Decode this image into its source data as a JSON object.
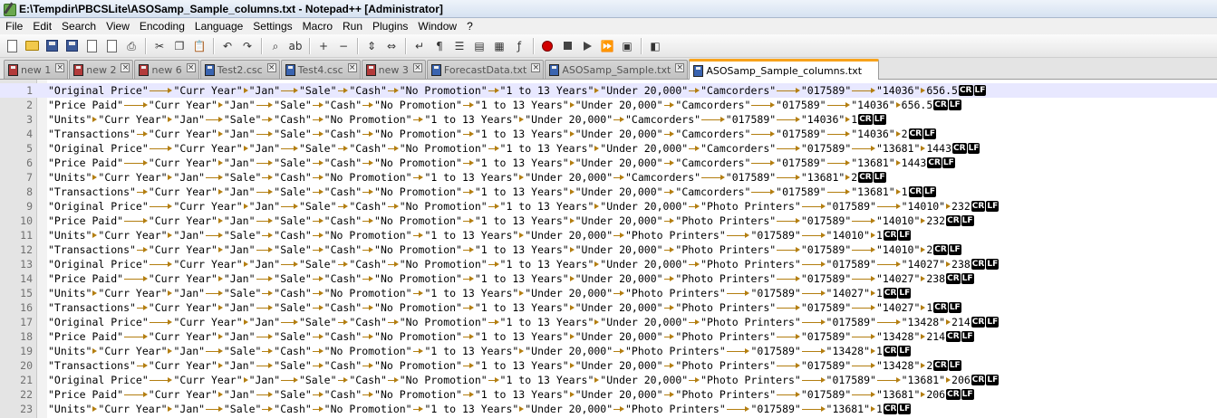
{
  "window": {
    "title": "E:\\Tempdir\\PBCSLite\\ASOSamp_Sample_columns.txt - Notepad++ [Administrator]"
  },
  "menu": [
    "File",
    "Edit",
    "Search",
    "View",
    "Encoding",
    "Language",
    "Settings",
    "Macro",
    "Run",
    "Plugins",
    "Window",
    "?"
  ],
  "toolbar": [
    {
      "name": "new-file",
      "icon": "new-file-icon",
      "glyph": ""
    },
    {
      "name": "open-file",
      "icon": "folder-icon",
      "glyph": ""
    },
    {
      "name": "save",
      "icon": "save-icon",
      "glyph": ""
    },
    {
      "name": "save-all",
      "icon": "save-all-icon",
      "glyph": ""
    },
    {
      "name": "close",
      "icon": "close-file-icon",
      "glyph": ""
    },
    {
      "name": "close-all",
      "icon": "close-all-icon",
      "glyph": ""
    },
    {
      "name": "print",
      "icon": "print-icon",
      "glyph": "⎙"
    },
    {
      "name": "sep",
      "icon": "",
      "glyph": ""
    },
    {
      "name": "cut",
      "icon": "scissors-icon",
      "glyph": "✂"
    },
    {
      "name": "copy",
      "icon": "copy-icon",
      "glyph": "❐"
    },
    {
      "name": "paste",
      "icon": "paste-icon",
      "glyph": "📋"
    },
    {
      "name": "sep",
      "icon": "",
      "glyph": ""
    },
    {
      "name": "undo",
      "icon": "undo-icon",
      "glyph": "↶"
    },
    {
      "name": "redo",
      "icon": "redo-icon",
      "glyph": "↷"
    },
    {
      "name": "sep",
      "icon": "",
      "glyph": ""
    },
    {
      "name": "find",
      "icon": "binoculars-icon",
      "glyph": "⌕"
    },
    {
      "name": "replace",
      "icon": "replace-icon",
      "glyph": "ab"
    },
    {
      "name": "sep",
      "icon": "",
      "glyph": ""
    },
    {
      "name": "zoom-in",
      "icon": "zoom-in-icon",
      "glyph": "+"
    },
    {
      "name": "zoom-out",
      "icon": "zoom-out-icon",
      "glyph": "−"
    },
    {
      "name": "sep",
      "icon": "",
      "glyph": ""
    },
    {
      "name": "sync-vertical",
      "icon": "sync-vertical-icon",
      "glyph": "⇕"
    },
    {
      "name": "sync-horizontal",
      "icon": "sync-horizontal-icon",
      "glyph": "⇔"
    },
    {
      "name": "sep",
      "icon": "",
      "glyph": ""
    },
    {
      "name": "word-wrap",
      "icon": "word-wrap-icon",
      "glyph": "↵"
    },
    {
      "name": "show-all-characters",
      "icon": "pilcrow-icon",
      "glyph": "¶"
    },
    {
      "name": "indent-guide",
      "icon": "indent-guide-icon",
      "glyph": "☰"
    },
    {
      "name": "user-defined-language",
      "icon": "udl-icon",
      "glyph": "▤"
    },
    {
      "name": "document-map",
      "icon": "document-map-icon",
      "glyph": "▦"
    },
    {
      "name": "function-list",
      "icon": "function-list-icon",
      "glyph": "ƒ"
    },
    {
      "name": "sep",
      "icon": "",
      "glyph": ""
    },
    {
      "name": "record-macro",
      "icon": "record-icon",
      "glyph": ""
    },
    {
      "name": "stop-recording",
      "icon": "stop-icon",
      "glyph": ""
    },
    {
      "name": "playback-macro",
      "icon": "play-icon",
      "glyph": ""
    },
    {
      "name": "run-macro-multiple",
      "icon": "fast-forward-icon",
      "glyph": "⏩"
    },
    {
      "name": "save-macro",
      "icon": "save-macro-icon",
      "glyph": "▣"
    },
    {
      "name": "sep",
      "icon": "",
      "glyph": ""
    },
    {
      "name": "launch-browser",
      "icon": "launch-icon",
      "glyph": "◧"
    }
  ],
  "tabs": [
    {
      "label": "new 1",
      "saved": false,
      "active": false
    },
    {
      "label": "new 2",
      "saved": false,
      "active": false
    },
    {
      "label": "new 6",
      "saved": false,
      "active": false
    },
    {
      "label": "Test2.csc",
      "saved": true,
      "active": false
    },
    {
      "label": "Test4.csc",
      "saved": true,
      "active": false
    },
    {
      "label": "new 3",
      "saved": false,
      "active": false
    },
    {
      "label": "ForecastData.txt",
      "saved": true,
      "active": false
    },
    {
      "label": "ASOSamp_Sample.txt",
      "saved": true,
      "active": false
    },
    {
      "label": "ASOSamp_Sample_columns.txt",
      "saved": true,
      "active": true
    }
  ],
  "tab_close_glyph": "×",
  "eol_marks": [
    "CR",
    "LF"
  ],
  "editor": {
    "current_line": 1,
    "lines": [
      {
        "n": "1",
        "segs": [
          "\"Original Price\"",
          "\"Curr Year\"",
          "\"Jan\"",
          "\"Sale\"",
          "\"Cash\"",
          "\"No Promotion\"",
          "\"1 to 13 Years\"",
          "\"Under 20,000\"",
          "\"Camcorders\"",
          "\"017589\"",
          "\"14036\"",
          "656.5"
        ]
      },
      {
        "n": "2",
        "segs": [
          "\"Price Paid\"",
          "\"Curr Year\"",
          "\"Jan\"",
          "\"Sale\"",
          "\"Cash\"",
          "\"No Promotion\"",
          "\"1 to 13 Years\"",
          "\"Under 20,000\"",
          "\"Camcorders\"",
          "\"017589\"",
          "\"14036\"",
          "656.5"
        ]
      },
      {
        "n": "3",
        "segs": [
          "\"Units\"",
          "\"Curr Year\"",
          "\"Jan\"",
          "\"Sale\"",
          "\"Cash\"",
          "\"No Promotion\"",
          "\"1 to 13 Years\"",
          "\"Under 20,000\"",
          "\"Camcorders\"",
          "\"017589\"",
          "\"14036\"",
          "1"
        ]
      },
      {
        "n": "4",
        "segs": [
          "\"Transactions\"",
          "\"Curr Year\"",
          "\"Jan\"",
          "\"Sale\"",
          "\"Cash\"",
          "\"No Promotion\"",
          "\"1 to 13 Years\"",
          "\"Under 20,000\"",
          "\"Camcorders\"",
          "\"017589\"",
          "\"14036\"",
          "2"
        ]
      },
      {
        "n": "5",
        "segs": [
          "\"Original Price\"",
          "\"Curr Year\"",
          "\"Jan\"",
          "\"Sale\"",
          "\"Cash\"",
          "\"No Promotion\"",
          "\"1 to 13 Years\"",
          "\"Under 20,000\"",
          "\"Camcorders\"",
          "\"017589\"",
          "\"13681\"",
          "1443"
        ]
      },
      {
        "n": "6",
        "segs": [
          "\"Price Paid\"",
          "\"Curr Year\"",
          "\"Jan\"",
          "\"Sale\"",
          "\"Cash\"",
          "\"No Promotion\"",
          "\"1 to 13 Years\"",
          "\"Under 20,000\"",
          "\"Camcorders\"",
          "\"017589\"",
          "\"13681\"",
          "1443"
        ]
      },
      {
        "n": "7",
        "segs": [
          "\"Units\"",
          "\"Curr Year\"",
          "\"Jan\"",
          "\"Sale\"",
          "\"Cash\"",
          "\"No Promotion\"",
          "\"1 to 13 Years\"",
          "\"Under 20,000\"",
          "\"Camcorders\"",
          "\"017589\"",
          "\"13681\"",
          "2"
        ]
      },
      {
        "n": "8",
        "segs": [
          "\"Transactions\"",
          "\"Curr Year\"",
          "\"Jan\"",
          "\"Sale\"",
          "\"Cash\"",
          "\"No Promotion\"",
          "\"1 to 13 Years\"",
          "\"Under 20,000\"",
          "\"Camcorders\"",
          "\"017589\"",
          "\"13681\"",
          "1"
        ]
      },
      {
        "n": "9",
        "segs": [
          "\"Original Price\"",
          "\"Curr Year\"",
          "\"Jan\"",
          "\"Sale\"",
          "\"Cash\"",
          "\"No Promotion\"",
          "\"1 to 13 Years\"",
          "\"Under 20,000\"",
          "\"Photo Printers\"",
          "\"017589\"",
          "\"14010\"",
          "232"
        ]
      },
      {
        "n": "10",
        "segs": [
          "\"Price Paid\"",
          "\"Curr Year\"",
          "\"Jan\"",
          "\"Sale\"",
          "\"Cash\"",
          "\"No Promotion\"",
          "\"1 to 13 Years\"",
          "\"Under 20,000\"",
          "\"Photo Printers\"",
          "\"017589\"",
          "\"14010\"",
          "232"
        ]
      },
      {
        "n": "11",
        "segs": [
          "\"Units\"",
          "\"Curr Year\"",
          "\"Jan\"",
          "\"Sale\"",
          "\"Cash\"",
          "\"No Promotion\"",
          "\"1 to 13 Years\"",
          "\"Under 20,000\"",
          "\"Photo Printers\"",
          "\"017589\"",
          "\"14010\"",
          "1"
        ]
      },
      {
        "n": "12",
        "segs": [
          "\"Transactions\"",
          "\"Curr Year\"",
          "\"Jan\"",
          "\"Sale\"",
          "\"Cash\"",
          "\"No Promotion\"",
          "\"1 to 13 Years\"",
          "\"Under 20,000\"",
          "\"Photo Printers\"",
          "\"017589\"",
          "\"14010\"",
          "2"
        ]
      },
      {
        "n": "13",
        "segs": [
          "\"Original Price\"",
          "\"Curr Year\"",
          "\"Jan\"",
          "\"Sale\"",
          "\"Cash\"",
          "\"No Promotion\"",
          "\"1 to 13 Years\"",
          "\"Under 20,000\"",
          "\"Photo Printers\"",
          "\"017589\"",
          "\"14027\"",
          "238"
        ]
      },
      {
        "n": "14",
        "segs": [
          "\"Price Paid\"",
          "\"Curr Year\"",
          "\"Jan\"",
          "\"Sale\"",
          "\"Cash\"",
          "\"No Promotion\"",
          "\"1 to 13 Years\"",
          "\"Under 20,000\"",
          "\"Photo Printers\"",
          "\"017589\"",
          "\"14027\"",
          "238"
        ]
      },
      {
        "n": "15",
        "segs": [
          "\"Units\"",
          "\"Curr Year\"",
          "\"Jan\"",
          "\"Sale\"",
          "\"Cash\"",
          "\"No Promotion\"",
          "\"1 to 13 Years\"",
          "\"Under 20,000\"",
          "\"Photo Printers\"",
          "\"017589\"",
          "\"14027\"",
          "1"
        ]
      },
      {
        "n": "16",
        "segs": [
          "\"Transactions\"",
          "\"Curr Year\"",
          "\"Jan\"",
          "\"Sale\"",
          "\"Cash\"",
          "\"No Promotion\"",
          "\"1 to 13 Years\"",
          "\"Under 20,000\"",
          "\"Photo Printers\"",
          "\"017589\"",
          "\"14027\"",
          "1"
        ]
      },
      {
        "n": "17",
        "segs": [
          "\"Original Price\"",
          "\"Curr Year\"",
          "\"Jan\"",
          "\"Sale\"",
          "\"Cash\"",
          "\"No Promotion\"",
          "\"1 to 13 Years\"",
          "\"Under 20,000\"",
          "\"Photo Printers\"",
          "\"017589\"",
          "\"13428\"",
          "214"
        ]
      },
      {
        "n": "18",
        "segs": [
          "\"Price Paid\"",
          "\"Curr Year\"",
          "\"Jan\"",
          "\"Sale\"",
          "\"Cash\"",
          "\"No Promotion\"",
          "\"1 to 13 Years\"",
          "\"Under 20,000\"",
          "\"Photo Printers\"",
          "\"017589\"",
          "\"13428\"",
          "214"
        ]
      },
      {
        "n": "19",
        "segs": [
          "\"Units\"",
          "\"Curr Year\"",
          "\"Jan\"",
          "\"Sale\"",
          "\"Cash\"",
          "\"No Promotion\"",
          "\"1 to 13 Years\"",
          "\"Under 20,000\"",
          "\"Photo Printers\"",
          "\"017589\"",
          "\"13428\"",
          "1"
        ]
      },
      {
        "n": "20",
        "segs": [
          "\"Transactions\"",
          "\"Curr Year\"",
          "\"Jan\"",
          "\"Sale\"",
          "\"Cash\"",
          "\"No Promotion\"",
          "\"1 to 13 Years\"",
          "\"Under 20,000\"",
          "\"Photo Printers\"",
          "\"017589\"",
          "\"13428\"",
          "2"
        ]
      },
      {
        "n": "21",
        "segs": [
          "\"Original Price\"",
          "\"Curr Year\"",
          "\"Jan\"",
          "\"Sale\"",
          "\"Cash\"",
          "\"No Promotion\"",
          "\"1 to 13 Years\"",
          "\"Under 20,000\"",
          "\"Photo Printers\"",
          "\"017589\"",
          "\"13681\"",
          "206"
        ]
      },
      {
        "n": "22",
        "segs": [
          "\"Price Paid\"",
          "\"Curr Year\"",
          "\"Jan\"",
          "\"Sale\"",
          "\"Cash\"",
          "\"No Promotion\"",
          "\"1 to 13 Years\"",
          "\"Under 20,000\"",
          "\"Photo Printers\"",
          "\"017589\"",
          "\"13681\"",
          "206"
        ]
      },
      {
        "n": "23",
        "segs": [
          "\"Units\"",
          "\"Curr Year\"",
          "\"Jan\"",
          "\"Sale\"",
          "\"Cash\"",
          "\"No Promotion\"",
          "\"1 to 13 Years\"",
          "\"Under 20,000\"",
          "\"Photo Printers\"",
          "\"017589\"",
          "\"13681\"",
          "1"
        ]
      }
    ]
  }
}
